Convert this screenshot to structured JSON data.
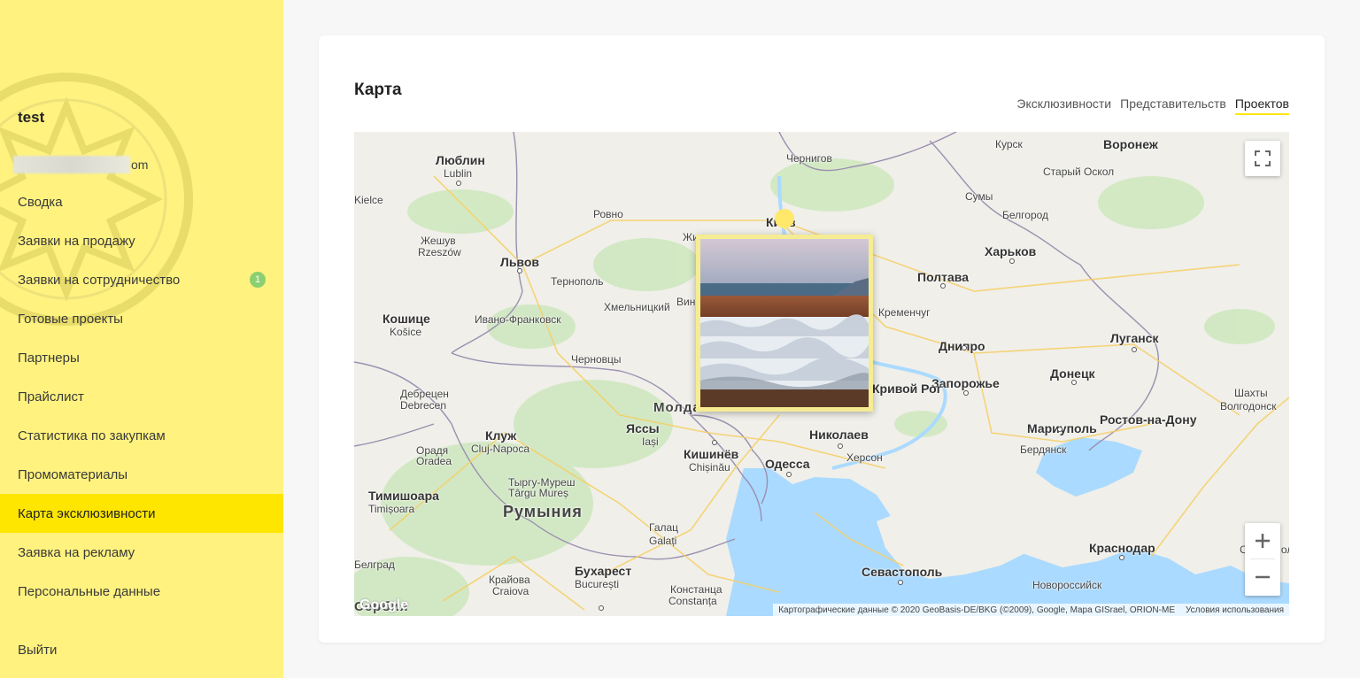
{
  "sidebar": {
    "username": "test",
    "email_suffix": "om",
    "items": [
      {
        "label": "Сводка",
        "name": "nav-summary"
      },
      {
        "label": "Заявки на продажу",
        "name": "nav-sale-requests"
      },
      {
        "label": "Заявки на сотрудничество",
        "name": "nav-cooperation-requests",
        "badge": "1"
      },
      {
        "label": "Готовые проекты",
        "name": "nav-ready-projects"
      },
      {
        "label": "Партнеры",
        "name": "nav-partners"
      },
      {
        "label": "Прайслист",
        "name": "nav-pricelist"
      },
      {
        "label": "Статистика по закупкам",
        "name": "nav-purchase-stats"
      },
      {
        "label": "Промоматериалы",
        "name": "nav-promo-materials"
      },
      {
        "label": "Карта эксклюзивности",
        "name": "nav-exclusivity-map",
        "active": true
      },
      {
        "label": "Заявка на рекламу",
        "name": "nav-ad-request"
      },
      {
        "label": "Персональные данные",
        "name": "nav-personal-data"
      }
    ],
    "logout": "Выйти"
  },
  "card": {
    "title": "Карта",
    "tabs": [
      {
        "label": "Эксклюзивности",
        "active": false
      },
      {
        "label": "Представительств",
        "active": false
      },
      {
        "label": "Проектов",
        "active": true
      }
    ]
  },
  "map": {
    "countries": [
      "Молдавия",
      "Румыния",
      "Сербия"
    ],
    "labels": [
      "Курск",
      "Воронеж",
      "Чернигов",
      "Старый Оскол",
      "Сумы",
      "Белгород",
      "Люблин",
      "Lublin",
      "Kielce",
      "Ровно",
      "Киев",
      "Жешув",
      "Rzeszów",
      "Львов",
      "Житомир",
      "Харьков",
      "Полтава",
      "Тернополь",
      "Хмельницкий",
      "Винница",
      "Кременчуг",
      "Кошице",
      "Košice",
      "Ивано-Франковск",
      "Днипро",
      "Луганск",
      "Черновцы",
      "Запорожье",
      "Донецк",
      "Дебрецен",
      "Debrecen",
      "Шахты",
      "Волгодонск",
      "Кривой Рог",
      "Ростов-на-Дону",
      "Яссы",
      "Iași",
      "Мариуполь",
      "Клуж",
      "Cluj-Napoca",
      "Николаев",
      "Кишинёв",
      "Chișinău",
      "Бердянск",
      "Херсон",
      "Орадя",
      "Oradea",
      "Одесса",
      "Тыргу-Муреш",
      "Târgu Mureș",
      "Тимишоара",
      "Timișoara",
      "Краснодар",
      "Галац",
      "Galați",
      "Бухарест",
      "București",
      "Севастополь",
      "Новороссийск",
      "Крайова",
      "Craiova",
      "Белград",
      "Констанца",
      "Constanța",
      "Ставрополь"
    ],
    "attribution": "Картографические данные © 2020 GeoBasis-DE/BKG (©2009), Google, Mapa GISrael, ORION-ME",
    "terms": "Условия использования",
    "google_logo": "Google",
    "controls": {
      "fullscreen": "fullscreen",
      "zoom_in": "+",
      "zoom_out": "−"
    }
  },
  "colors": {
    "sidebar_bg": "#fff27f",
    "active_item": "#ffe600",
    "badge": "#8ccf70",
    "sea": "#aadaff",
    "pin": "#ffe86a"
  }
}
